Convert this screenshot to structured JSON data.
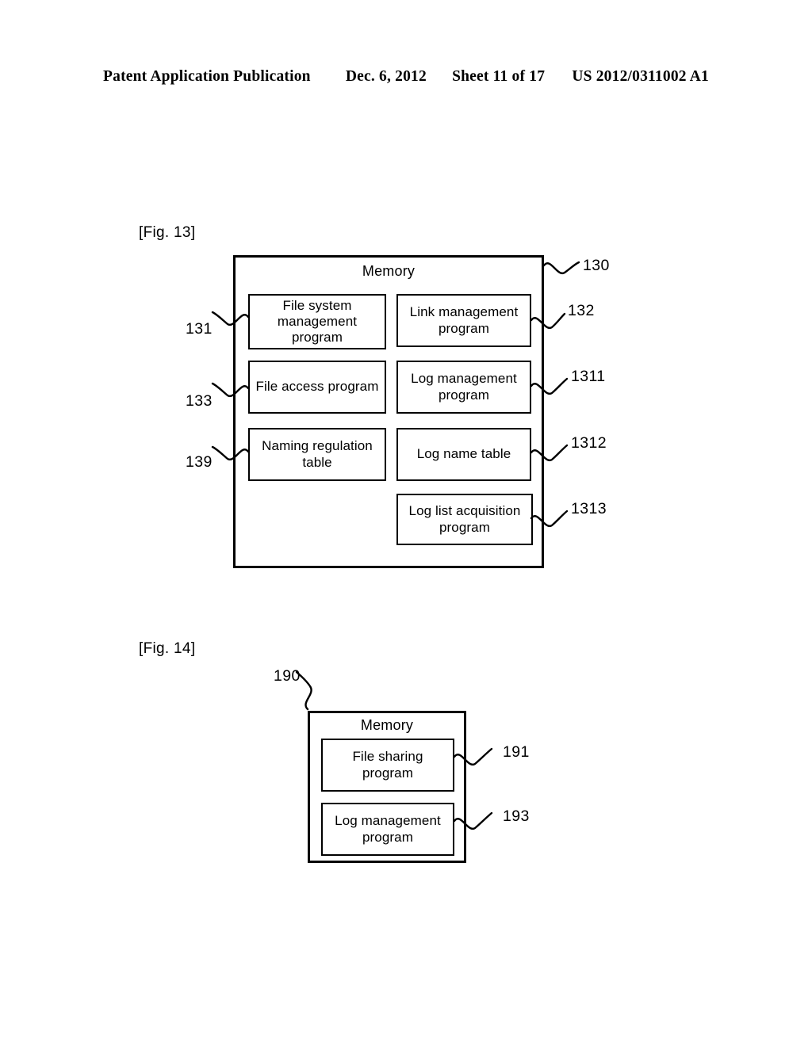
{
  "header": {
    "publication": "Patent Application Publication",
    "date": "Dec. 6, 2012",
    "sheet": "Sheet 11 of 17",
    "doc_number": "US 2012/0311002 A1"
  },
  "figures": [
    {
      "label": "[Fig. 13]",
      "container": {
        "title": "Memory",
        "ref": "130"
      },
      "blocks": [
        {
          "text": "File system management program",
          "ref": "131",
          "ref_side": "left"
        },
        {
          "text": "Link management program",
          "ref": "132",
          "ref_side": "right"
        },
        {
          "text": "File access program",
          "ref": "133",
          "ref_side": "left"
        },
        {
          "text": "Log management program",
          "ref": "1311",
          "ref_side": "right"
        },
        {
          "text": "Naming regulation table",
          "ref": "139",
          "ref_side": "left"
        },
        {
          "text": "Log name table",
          "ref": "1312",
          "ref_side": "right"
        },
        {
          "text": "Log list acquisition program",
          "ref": "1313",
          "ref_side": "right"
        }
      ]
    },
    {
      "label": "[Fig. 14]",
      "container": {
        "title": "Memory",
        "ref": "190"
      },
      "blocks": [
        {
          "text": "File sharing program",
          "ref": "191",
          "ref_side": "right"
        },
        {
          "text": "Log management program",
          "ref": "193",
          "ref_side": "right"
        }
      ]
    }
  ]
}
